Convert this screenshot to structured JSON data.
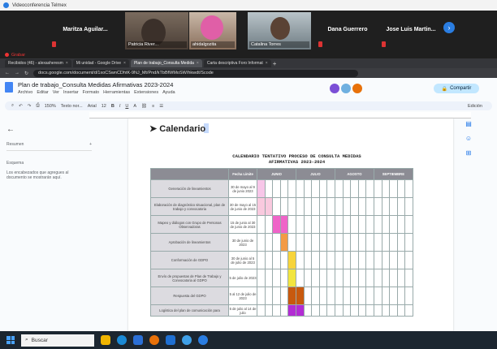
{
  "vc": {
    "window_title": "Videoconferencia Telmex",
    "participants": [
      {
        "name": "Maritza Aguilar..."
      },
      {
        "name": "Patricia River..."
      },
      {
        "name": "ahidalgozita"
      },
      {
        "name": "Catalina Torres"
      },
      {
        "name": "Dana Guerrero"
      },
      {
        "name": "Jose Luis Martin..."
      }
    ],
    "recording_label": "Grabar"
  },
  "browser": {
    "tabs": [
      {
        "label": "Recibidos (46) - alexasheresm"
      },
      {
        "label": "Mi unidad - Google Drive"
      },
      {
        "label": "Plan de trabajo_Consulta Medida"
      },
      {
        "label": "Carta descriptiva Foro Informat"
      }
    ],
    "url": "docs.google.com/document/d/1xoCSwnCDhtK-9NJ_Mt/Pnd/kTbBfWMoSW/hkwdt/Scode"
  },
  "doc": {
    "title": "Plan de trabajo_Consulta Medidas Afirmativas 2023-2024",
    "menu": [
      "Archivo",
      "Editar",
      "Ver",
      "Insertar",
      "Formato",
      "Herramientas",
      "Extensiones",
      "Ayuda"
    ],
    "share_label": "Compartir",
    "toolbar": {
      "zoom": "150%",
      "style": "Texto nor...",
      "font": "Arial",
      "size": "12",
      "edit_mode": "Edición"
    },
    "outline": {
      "resumen": "Resumen",
      "esquema": "Esquema",
      "hint": "Los encabezados que agregues al documento se mostrarán aquí."
    },
    "heading": "Calendario",
    "table_title_line1": "CALENDARIO TENTATIVO PROCESO DE CONSULTA MEDIDAS",
    "table_title_line2": "AFIRMATIVAS 2023-2024",
    "table": {
      "headers": [
        "",
        "Fecha Límite",
        "JUNIO",
        "JULIO",
        "AGOSTO",
        "SEPTIEMBRE"
      ],
      "rows": [
        {
          "activity": "Generación de lineamientos",
          "date": "30 de mayo al 9 de junio 2023",
          "color": "#f7c6e8",
          "start": 0,
          "span": 1
        },
        {
          "activity": "Elaboración de diagnóstico situacional, plan de trabajo y convocatoria",
          "date": "30 de mayo al 15 de junio de 2023",
          "color": "#f9c9de",
          "start": 0,
          "span": 2
        },
        {
          "activity": "Mapeo y diálogos con Grupo de Personas Observadoras",
          "date": "15 de junio al 30 de junio de 2023",
          "color": "#ef64c8",
          "start": 2,
          "span": 2
        },
        {
          "activity": "Aprobación de lineamientos",
          "date": "30 de junio de 2023",
          "color": "#f39b45",
          "start": 3,
          "span": 1
        },
        {
          "activity": "Conformación de GDPO",
          "date": "30 de junio al 5 de julio de 2023",
          "color": "#f7d43b",
          "start": 4,
          "span": 1
        },
        {
          "activity": "Envío de propuestas de Plan de Trabajo y Convocatoria al GDPO",
          "date": "5 de julio de 2023",
          "color": "#f2e53f",
          "start": 4,
          "span": 1
        },
        {
          "activity": "Respuesta del GDPO",
          "date": "5 al 12 de julio de 2023",
          "color": "#c8590e",
          "start": 4,
          "span": 2
        },
        {
          "activity": "Logística del plan de comunicación para",
          "date": "5 de julio al 14 de julio",
          "color": "#b32cd4",
          "start": 4,
          "span": 2
        }
      ]
    }
  },
  "taskbar": {
    "search_label": "Buscar"
  }
}
